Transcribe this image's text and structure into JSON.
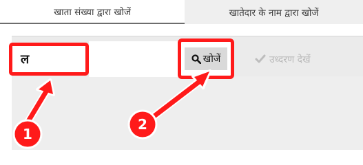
{
  "tabs": [
    {
      "label": "खाता संख्या द्वारा खोजें",
      "active": true
    },
    {
      "label": "खातेदार के नाम द्वारा खोजें",
      "active": false
    }
  ],
  "search": {
    "value": "ल",
    "button_label": "खोजें",
    "button_icon": "search-icon"
  },
  "view_button": {
    "label": "उध्दरण देखें",
    "icon": "check-icon",
    "disabled": true
  },
  "annotations": {
    "badge_1": "1",
    "badge_2": "2",
    "highlight_color": "#ff1a1a"
  }
}
